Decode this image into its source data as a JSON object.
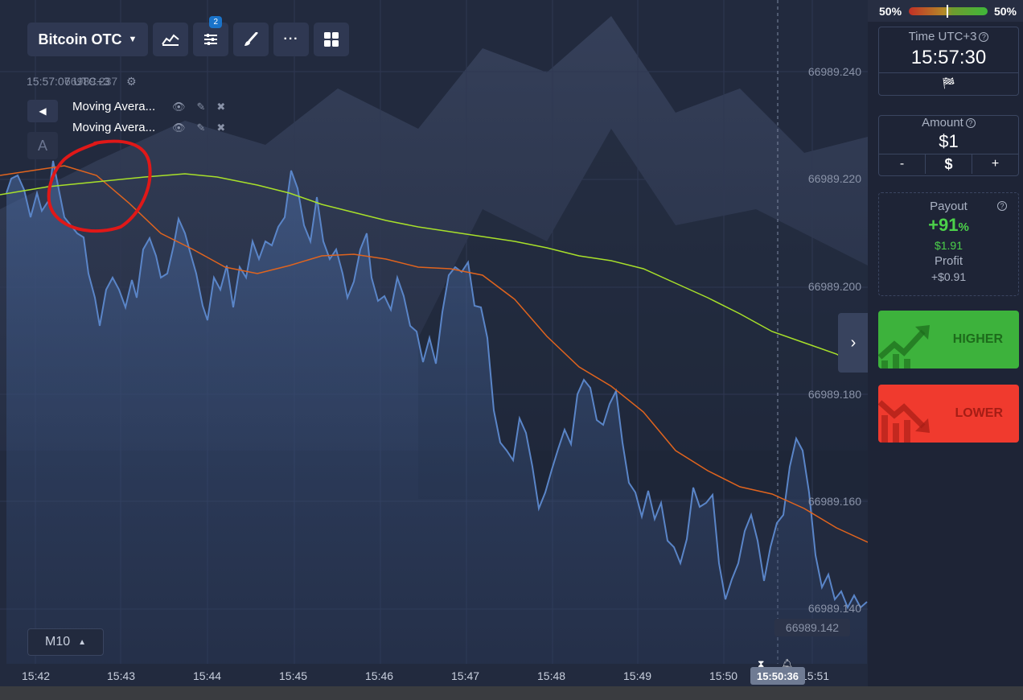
{
  "toolbar": {
    "asset": "Bitcoin OTC",
    "indicator_badge": "2"
  },
  "chart": {
    "server_time": "15:57:07 UTC+3",
    "overlay_price": "66989.237",
    "indicators": [
      {
        "label": "Moving Avera..."
      },
      {
        "label": "Moving Avera..."
      }
    ],
    "drawing_tool_label": "A",
    "price_axis": [
      "66989.240",
      "66989.220",
      "66989.200",
      "66989.180",
      "66989.160",
      "66989.140"
    ],
    "current_price": "66989.142",
    "timeframe": "M10",
    "time_axis": [
      "15:42",
      "15:43",
      "15:44",
      "15:45",
      "15:46",
      "15:47",
      "15:48",
      "15:49",
      "15:50",
      "15:51"
    ],
    "expiry_time": "15:50:36",
    "colors": {
      "price_line": "#5a85c8",
      "ma_fast": "#e0641e",
      "ma_slow": "#a8e02a",
      "annotation": "#e01818"
    }
  },
  "sidebar": {
    "sentiment_left": "50%",
    "sentiment_right": "50%",
    "time_title": "Time UTC+3",
    "time_value": "15:57:30",
    "amount_title": "Amount",
    "amount_value": "$1",
    "amount_minus": "-",
    "amount_currency": "$",
    "amount_plus": "+",
    "payout_title": "Payout",
    "payout_percent": "+91",
    "payout_percent_sign": "%",
    "payout_amount": "$1.91",
    "profit_label": "Profit",
    "profit_value": "+$0.91",
    "higher_label": "HIGHER",
    "lower_label": "LOWER"
  }
}
